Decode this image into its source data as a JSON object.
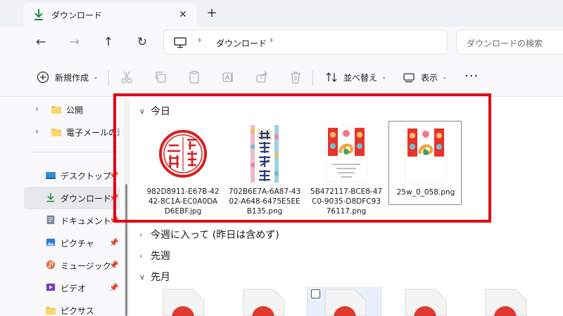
{
  "tab": {
    "title": "ダウンロード",
    "close": "✕",
    "new_tab": "+"
  },
  "nav": {
    "back": "←",
    "forward": "→",
    "up": "↑",
    "refresh": "↻"
  },
  "address": {
    "separator": "›",
    "crumb": "ダウンロード"
  },
  "search": {
    "placeholder": "ダウンロードの検索"
  },
  "commands": {
    "new_label": "新規作成",
    "sort_label": "並べ替え",
    "view_label": "表示",
    "more": "···",
    "chevron": "⌄"
  },
  "sidebar": {
    "top_items": [
      {
        "label": "公開",
        "caret": "›"
      },
      {
        "label": "電子メールの添付",
        "caret": "›"
      }
    ],
    "quick_access": [
      {
        "label": "デスクトップ",
        "pin": "📌",
        "icon": "desktop-icon"
      },
      {
        "label": "ダウンロード",
        "pin": "📌",
        "icon": "download-icon",
        "selected": true
      },
      {
        "label": "ドキュメント",
        "pin": "📌",
        "icon": "document-icon"
      },
      {
        "label": "ピクチャ",
        "pin": "📌",
        "icon": "picture-icon"
      },
      {
        "label": "ミュージック",
        "pin": "📌",
        "icon": "music-icon"
      },
      {
        "label": "ビデオ",
        "pin": "📌",
        "icon": "video-icon"
      },
      {
        "label": "ピクサス",
        "icon": "folder-icon"
      }
    ]
  },
  "groups": {
    "today": "今日",
    "this_week": "今週に入って (昨日は含めず)",
    "last_week": "先週",
    "last_month": "先月",
    "chev_open": "∨",
    "chev_closed": "›"
  },
  "files": [
    {
      "name": "982D8911-E67B-4242-8C1A-EC0A0DAD6EBF.jpg",
      "thumb": "seal-stamp"
    },
    {
      "name": "702B6E7A-6A87-4302-A648-6475E5EEB135.png",
      "thumb": "new-year-card-vertical"
    },
    {
      "name": "5B472117-BCE8-47C0-9035-D8DFC9376117.png",
      "thumb": "new-year-card-dragon-text"
    },
    {
      "name": "25w_0_058.png",
      "thumb": "new-year-card-dragon",
      "selected": true
    }
  ],
  "colors": {
    "highlight": "#e60012",
    "folder": "#f2c94c",
    "accent": "#0067c0"
  }
}
